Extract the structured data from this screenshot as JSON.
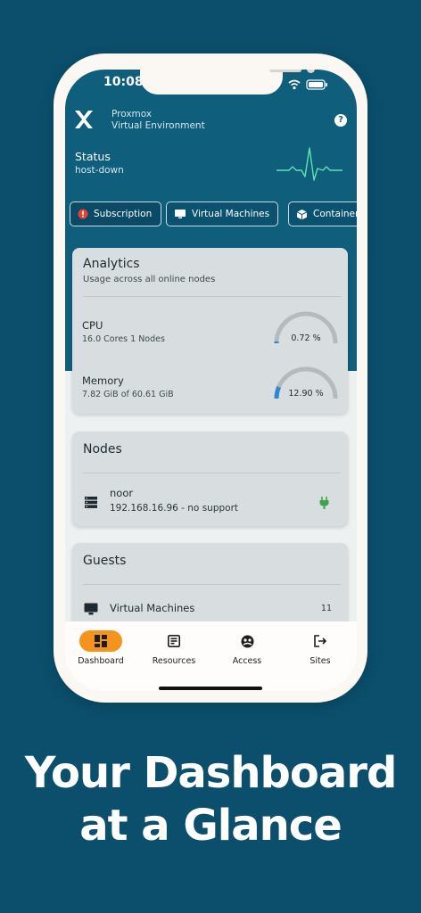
{
  "status_bar": {
    "time": "10:08"
  },
  "brand": {
    "line1": "Proxmox",
    "line2": "Virtual Environment"
  },
  "status": {
    "title": "Status",
    "value": "host-down"
  },
  "chips": [
    {
      "label": "Subscription",
      "icon": "error-icon"
    },
    {
      "label": "Virtual Machines",
      "icon": "monitor-icon"
    },
    {
      "label": "Containers",
      "icon": "box-icon"
    }
  ],
  "analytics": {
    "title": "Analytics",
    "subtitle": "Usage across all online nodes",
    "cpu": {
      "label": "CPU",
      "detail": "16.0 Cores 1 Nodes",
      "value": "0.72 %",
      "fraction": 0.0072
    },
    "memory": {
      "label": "Memory",
      "detail": "7.82 GiB of 60.61 GiB",
      "value": "12.90 %",
      "fraction": 0.129
    }
  },
  "nodes": {
    "title": "Nodes",
    "items": [
      {
        "name": "noor",
        "detail": "192.168.16.96 - no support",
        "status_color": "#3aa84a"
      }
    ]
  },
  "guests": {
    "title": "Guests",
    "items": [
      {
        "label": "Virtual Machines",
        "count": "11"
      }
    ]
  },
  "bottom_nav": [
    {
      "label": "Dashboard",
      "icon": "dashboard-icon",
      "active": true
    },
    {
      "label": "Resources",
      "icon": "resources-icon",
      "active": false
    },
    {
      "label": "Access",
      "icon": "access-icon",
      "active": false
    },
    {
      "label": "Sites",
      "icon": "logout-icon",
      "active": false
    }
  ],
  "headline": {
    "line1": "Your Dashboard",
    "line2": "at a Glance"
  },
  "colors": {
    "accent": "#f5941d",
    "teal": "#0e5e7c",
    "background": "#0b4f6c",
    "gauge_fill": "#2e86d6",
    "pulse": "#5fe0b4"
  }
}
